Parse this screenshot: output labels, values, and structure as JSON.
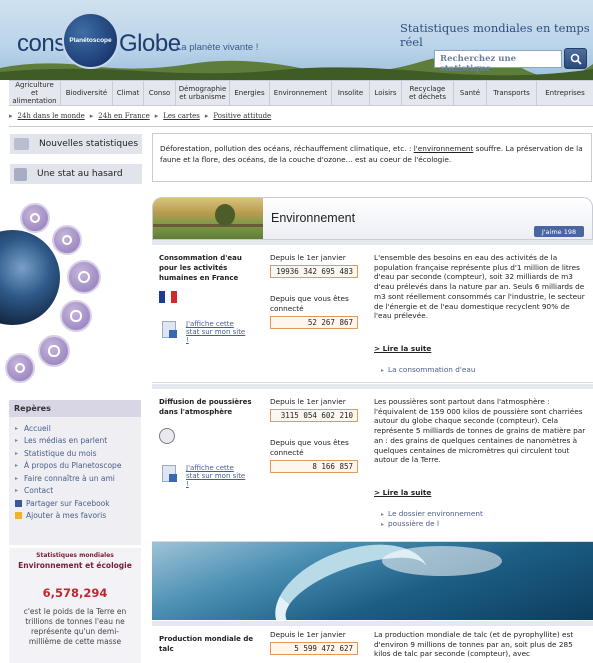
{
  "header": {
    "logo_left": "conso",
    "logo_badge": "Planétoscope",
    "logo_right": "Globe",
    "tagline": "La planète vivante !",
    "title": "Statistiques mondiales en temps réel",
    "search_placeholder": "Recherchez une statistique"
  },
  "nav": [
    "Agriculture et alimentation",
    "Biodiversité",
    "Climat",
    "Conso",
    "Démographie et urbanisme",
    "Energies",
    "Environnement",
    "Insolite",
    "Loisirs",
    "Recyclage et déchets",
    "Santé",
    "Transports",
    "Entreprises"
  ],
  "crumbs": [
    "24h dans le monde",
    "24h en France",
    "Les cartes",
    "Positive attitude"
  ],
  "sidebar": {
    "new_stats": "Nouvelles statistiques",
    "random_stat": "Une stat au hasard",
    "reperes_title": "Repères",
    "reperes_items": [
      "Accueil",
      "Les médias en parlent",
      "Statistique du mois",
      "À propos du Planetoscope",
      "Faire connaître à un ami",
      "Contact",
      "Partager sur Facebook",
      "Ajouter à mes favoris"
    ],
    "stat_title1": "Statistiques mondiales",
    "stat_title2": "Environnement et écologie",
    "stat_value": "6,578,294",
    "stat_text": "c'est le poids de la Terre en trillions de tonnes l'eau ne représente qu'un demi-millième de cette masse"
  },
  "intro": {
    "text_before": "Déforestation, pollution des océans, réchauffement climatique, etc. : ",
    "link": "l'environnement",
    "text_after": " souffre. La préservation de la faune et la flore, des océans, de la couche d'ozone... est au coeur de l'écologie."
  },
  "env": {
    "title": "Environnement",
    "like": "J'aime 198"
  },
  "blocks": [
    {
      "name": "Consommation d'eau pour les activités humaines en France",
      "since_jan": "Depuis le 1er janvier",
      "counter1": "19936 342 695 483",
      "since_visit": "Depuis que vous êtes connecté",
      "counter2": "52 267 867",
      "share": "J'affiche cette stat sur mon site !",
      "desc": "L'ensemble des besoins en eau des activités de la population française représente plus d'1 million de litres d'eau par seconde (compteur), soit 32 milliards de m3 d'eau prélevés dans la nature par an. Seuls 6 milliards de m3 sont réellement consommés car l'industrie, le secteur de l'énergie et de l'eau domestique recyclent 90% de l'eau prélevée.",
      "more": "> Lire la suite",
      "related": [
        "La consommation d'eau"
      ]
    },
    {
      "name": "Diffusion de poussières dans l'atmosphère",
      "since_jan": "Depuis le 1er janvier",
      "counter1": "3115 054 602 210",
      "since_visit": "Depuis que vous êtes connecté",
      "counter2": "8 166 857",
      "share": "J'affiche cette stat sur mon site !",
      "desc": "Les poussières sont partout dans l'atmosphère : l'équivalent de 159 000 kilos de poussière sont charriées autour du globe chaque seconde (compteur). Cela représente 5 milliards de tonnes de grains de matière par an : des grains de quelques centaines de nanomètres à quelques centaines de micromètres qui circulent tout autour de la Terre.",
      "more": "> Lire la suite",
      "related": [
        "Le dossier environnement",
        "poussière de l"
      ]
    },
    {
      "name": "Production mondiale de talc",
      "since_jan": "Depuis le 1er janvier",
      "counter1": "5 599 472 627",
      "desc": "La production mondiale de talc (et de pyrophyllite) est d'environ 9 millions de tonnes par an, soit plus de 285 kilos de talc par seconde (compteur), avec"
    }
  ]
}
